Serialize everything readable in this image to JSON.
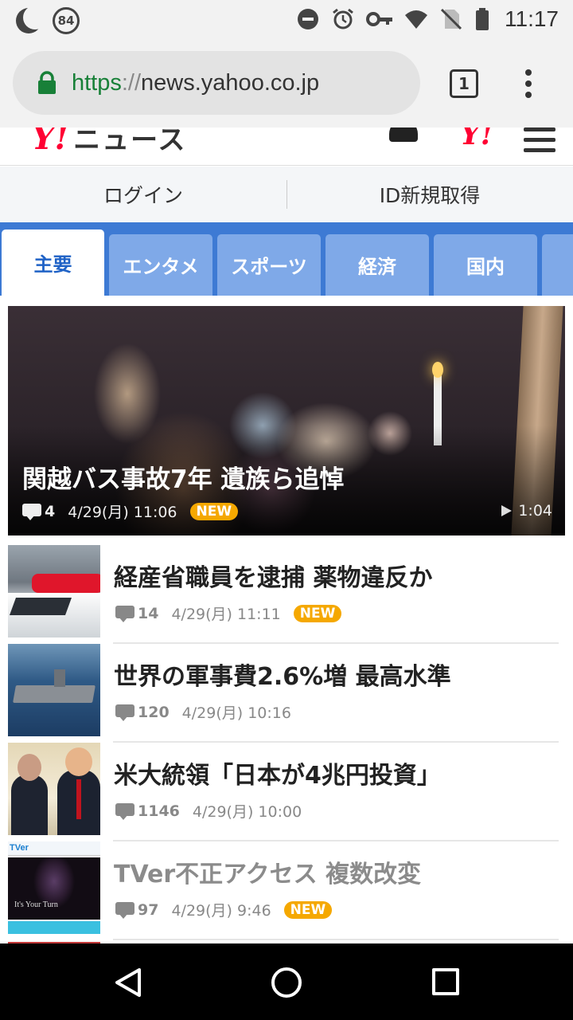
{
  "status_bar": {
    "notification_count": "84",
    "time": "11:17",
    "icons": [
      "moon-icon",
      "notification-badge",
      "do-not-disturb-icon",
      "alarm-icon",
      "key-icon",
      "wifi-icon",
      "no-sim-icon",
      "battery-icon"
    ]
  },
  "browser": {
    "url_scheme": "https",
    "url_separator": "://",
    "url_host": "news.yahoo.co.jp",
    "tab_count": "1",
    "accent_lock": "#188038"
  },
  "header": {
    "logo": "Y!",
    "logo_suffix": "ニュース",
    "yahoo_icon": "Y!"
  },
  "account": {
    "login_label": "ログイン",
    "signup_label": "ID新規取得"
  },
  "categories": {
    "tabs": [
      {
        "label": "主要",
        "active": true
      },
      {
        "label": "エンタメ",
        "active": false
      },
      {
        "label": "スポーツ",
        "active": false
      },
      {
        "label": "経済",
        "active": false
      },
      {
        "label": "国内",
        "active": false
      }
    ],
    "accent": "#3d7ad4"
  },
  "hero": {
    "title": "関越バス事故7年 遺族ら追悼",
    "comments": "4",
    "date": "4/29(月) 11:06",
    "badge": "NEW",
    "duration": "1:04"
  },
  "news": [
    {
      "headline": "経産省職員を逮捕 薬物違反か",
      "comments": "14",
      "date": "4/29(月) 11:11",
      "badge": "NEW",
      "visited": false
    },
    {
      "headline": "世界の軍事費2.6%増 最高水準",
      "comments": "120",
      "date": "4/29(月) 10:16",
      "badge": "",
      "visited": false
    },
    {
      "headline": "米大統領「日本が4兆円投資」",
      "comments": "1146",
      "date": "4/29(月) 10:00",
      "badge": "",
      "visited": false
    },
    {
      "headline": "TVer不正アクセス 複数改変",
      "comments": "97",
      "date": "4/29(月) 9:46",
      "badge": "NEW",
      "visited": true
    }
  ],
  "thumb_text": {
    "tver_logo": "TVer",
    "tver_caption": "It's Your Turn"
  },
  "colors": {
    "new_badge": "#f5a800",
    "yahoo_red": "#ff0033"
  }
}
